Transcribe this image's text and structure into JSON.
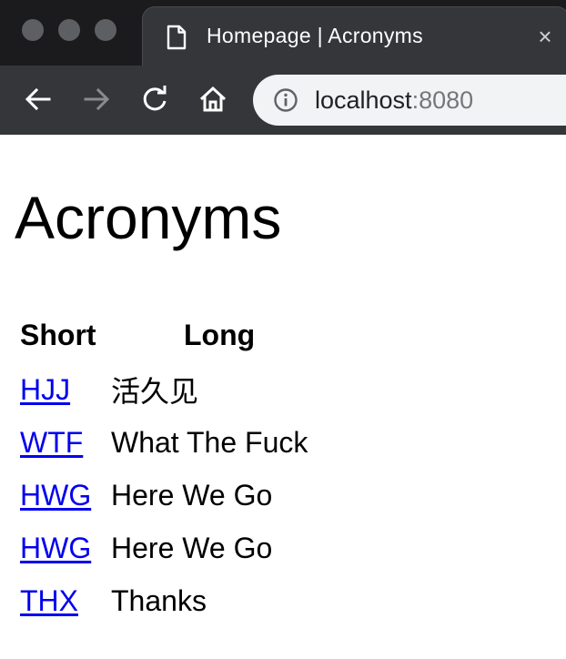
{
  "browser": {
    "tab_title": "Homepage | Acronyms",
    "tab_close": "×",
    "url_host": "localhost",
    "url_port": ":8080",
    "icons": {
      "tab": "document-icon",
      "back": "back-arrow-icon",
      "forward": "forward-arrow-icon",
      "reload": "reload-icon",
      "home": "home-icon",
      "info": "info-icon"
    }
  },
  "page": {
    "title": "Acronyms",
    "table": {
      "headers": {
        "short": "Short",
        "long": "Long"
      },
      "rows": [
        {
          "short": "HJJ",
          "long": "活久见"
        },
        {
          "short": "WTF",
          "long": "What The Fuck"
        },
        {
          "short": "HWG",
          "long": "Here We Go"
        },
        {
          "short": "HWG",
          "long": "Here We Go"
        },
        {
          "short": "THX",
          "long": "Thanks"
        }
      ]
    }
  },
  "colors": {
    "link": "#0000ee",
    "chrome_dark": "#202124",
    "tab_active": "#35363a",
    "omnibox": "#f1f3f4"
  }
}
